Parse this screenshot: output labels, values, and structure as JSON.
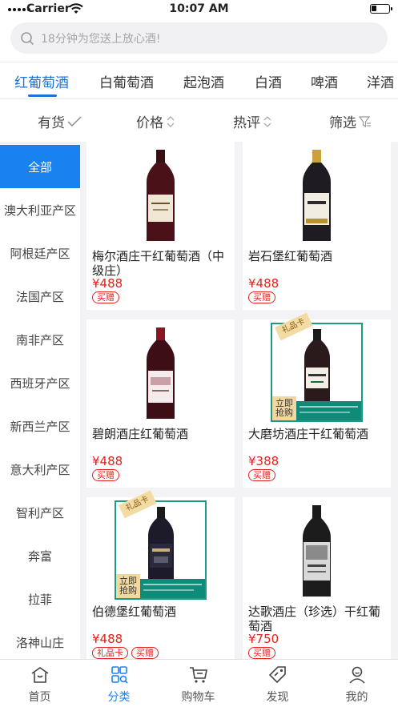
{
  "status_bar": {
    "carrier": "Carrier",
    "time": "10:07 AM"
  },
  "search": {
    "placeholder": "18分钟为您送上放心酒!"
  },
  "categories": [
    {
      "label": "红葡萄酒",
      "active": true
    },
    {
      "label": "白葡萄酒"
    },
    {
      "label": "起泡酒"
    },
    {
      "label": "白酒"
    },
    {
      "label": "啤酒"
    },
    {
      "label": "洋酒"
    }
  ],
  "sort": {
    "in_stock": "有货",
    "price": "价格",
    "rating": "热评",
    "filter": "筛选"
  },
  "sidebar": {
    "items": [
      {
        "label": "全部",
        "active": true
      },
      {
        "label": "澳大利亚产区"
      },
      {
        "label": "阿根廷产区"
      },
      {
        "label": "法国产区"
      },
      {
        "label": "南非产区"
      },
      {
        "label": "西班牙产区"
      },
      {
        "label": "新西兰产区"
      },
      {
        "label": "意大利产区"
      },
      {
        "label": "智利产区"
      },
      {
        "label": "奔富"
      },
      {
        "label": "拉菲"
      },
      {
        "label": "洛神山庄"
      }
    ]
  },
  "products": [
    {
      "name": "梅尔酒庄干红葡萄酒（中级庄）",
      "price": "¥488",
      "tags": [
        "买赠"
      ],
      "gift_card": false
    },
    {
      "name": "岩石堡红葡萄酒",
      "price": "¥488",
      "tags": [
        "买赠"
      ],
      "gift_card": false
    },
    {
      "name": "碧朗酒庄红葡萄酒",
      "price": "¥488",
      "tags": [
        "买赠"
      ],
      "gift_card": false
    },
    {
      "name": "大磨坊酒庄干红葡萄酒",
      "price": "¥388",
      "tags": [
        "买赠"
      ],
      "gift_card": true
    },
    {
      "name": "伯德堡红葡萄酒",
      "price": "¥488",
      "tags": [
        "礼品卡",
        "买赠"
      ],
      "gift_card": true
    },
    {
      "name": "达歌酒庄（珍选）干红葡萄酒",
      "price": "¥750",
      "tags": [
        "买赠"
      ],
      "gift_card": false
    }
  ],
  "promo": {
    "ribbon": "礼品卡",
    "buy_now": "立即抢购"
  },
  "tabbar": {
    "items": [
      {
        "label": "首页",
        "icon": "home-icon"
      },
      {
        "label": "分类",
        "icon": "category-icon",
        "active": true
      },
      {
        "label": "购物车",
        "icon": "cart-icon"
      },
      {
        "label": "发现",
        "icon": "discover-tag-icon"
      },
      {
        "label": "我的",
        "icon": "profile-icon"
      }
    ]
  },
  "colors": {
    "accent": "#1a82f0",
    "price": "#e0231b",
    "gift_frame": "#1d9a84"
  }
}
